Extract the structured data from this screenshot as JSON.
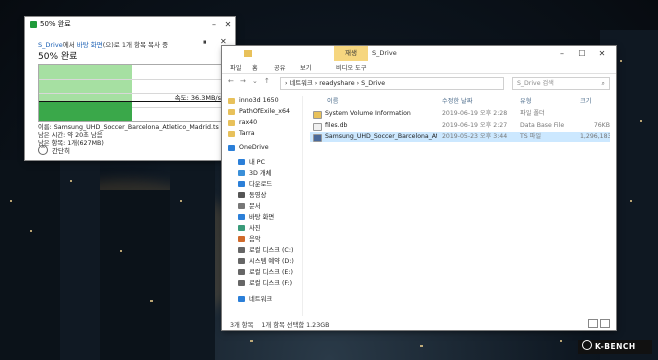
{
  "progress_dialog": {
    "title": "50% 완료",
    "copy_line_prefix": "S_Drive",
    "copy_line_mid": "에서 ",
    "copy_line_dest": "바탕 화면",
    "copy_line_suffix": "(으)로 1개 항목 복사 중",
    "percent_label": "50% 완료",
    "speed_label": "속도: 36.3MB/s",
    "progress_fraction": 0.5,
    "name_line": "이름: Samsung_UHD_Soccer_Barcelona_Atletico_Madrid.ts",
    "time_left_line": "남은 시간: 약 20초 남음",
    "items_left_line": "남은 항목: 1개(627MB)",
    "collapse_label": "간단히",
    "pause_glyph": "⏸",
    "close_glyph": "✕"
  },
  "explorer": {
    "context_tab": "재생",
    "window_title": "S_Drive",
    "ribbon": [
      "파일",
      "홈",
      "공유",
      "보기",
      "비디오 도구"
    ],
    "address_parts": [
      "네트워크",
      "readyshare",
      "S_Drive"
    ],
    "search_placeholder": "S_Drive 검색",
    "columns": [
      "이름",
      "수정한 날짜",
      "유형",
      "크기"
    ],
    "files": [
      {
        "name": "System Volume Information",
        "date": "2019-06-19 오후 2:28",
        "type": "파일 폴더",
        "size": "",
        "selected": false
      },
      {
        "name": "files.db",
        "date": "2019-06-19 오후 2:27",
        "type": "Data Base File",
        "size": "76KB",
        "selected": false
      },
      {
        "name": "Samsung_UHD_Soccer_Barcelona_Atleti...",
        "date": "2019-05-23 오후 3:44",
        "type": "TS 파일",
        "size": "1,296,183...",
        "selected": true
      }
    ],
    "nav_items": [
      {
        "label": "inno3d 1650",
        "icon": "folder-icon"
      },
      {
        "label": "PathOfExile_x64",
        "icon": "folder-icon"
      },
      {
        "label": "rax40",
        "icon": "folder-icon"
      },
      {
        "label": "Tarra",
        "icon": "folder-icon"
      },
      {
        "label": "OneDrive",
        "icon": "cloud-icon"
      },
      {
        "label": "내 PC",
        "icon": "pc-icon"
      },
      {
        "label": "3D 개체",
        "icon": "cube-icon"
      },
      {
        "label": "다운로드",
        "icon": "download-icon"
      },
      {
        "label": "동영상",
        "icon": "video-icon"
      },
      {
        "label": "문서",
        "icon": "document-icon"
      },
      {
        "label": "바탕 화면",
        "icon": "desktop-icon"
      },
      {
        "label": "사진",
        "icon": "picture-icon"
      },
      {
        "label": "음악",
        "icon": "music-icon"
      },
      {
        "label": "로컬 디스크 (C:)",
        "icon": "drive-icon"
      },
      {
        "label": "시스템 예약 (D:)",
        "icon": "drive-icon"
      },
      {
        "label": "로컬 디스크 (E:)",
        "icon": "drive-icon"
      },
      {
        "label": "로컬 디스크 (F:)",
        "icon": "drive-icon"
      },
      {
        "label": "네트워크",
        "icon": "network-icon"
      }
    ],
    "status_count": "3개 항목",
    "status_selected": "1개 항목 선택함 1.23GB"
  },
  "brand_logo": "K-BENCH",
  "colors": {
    "accent": "#1a5fb4",
    "progress_green": "#a6e0a2",
    "context_tab": "#f6d67f",
    "selection": "#cce8ff"
  }
}
